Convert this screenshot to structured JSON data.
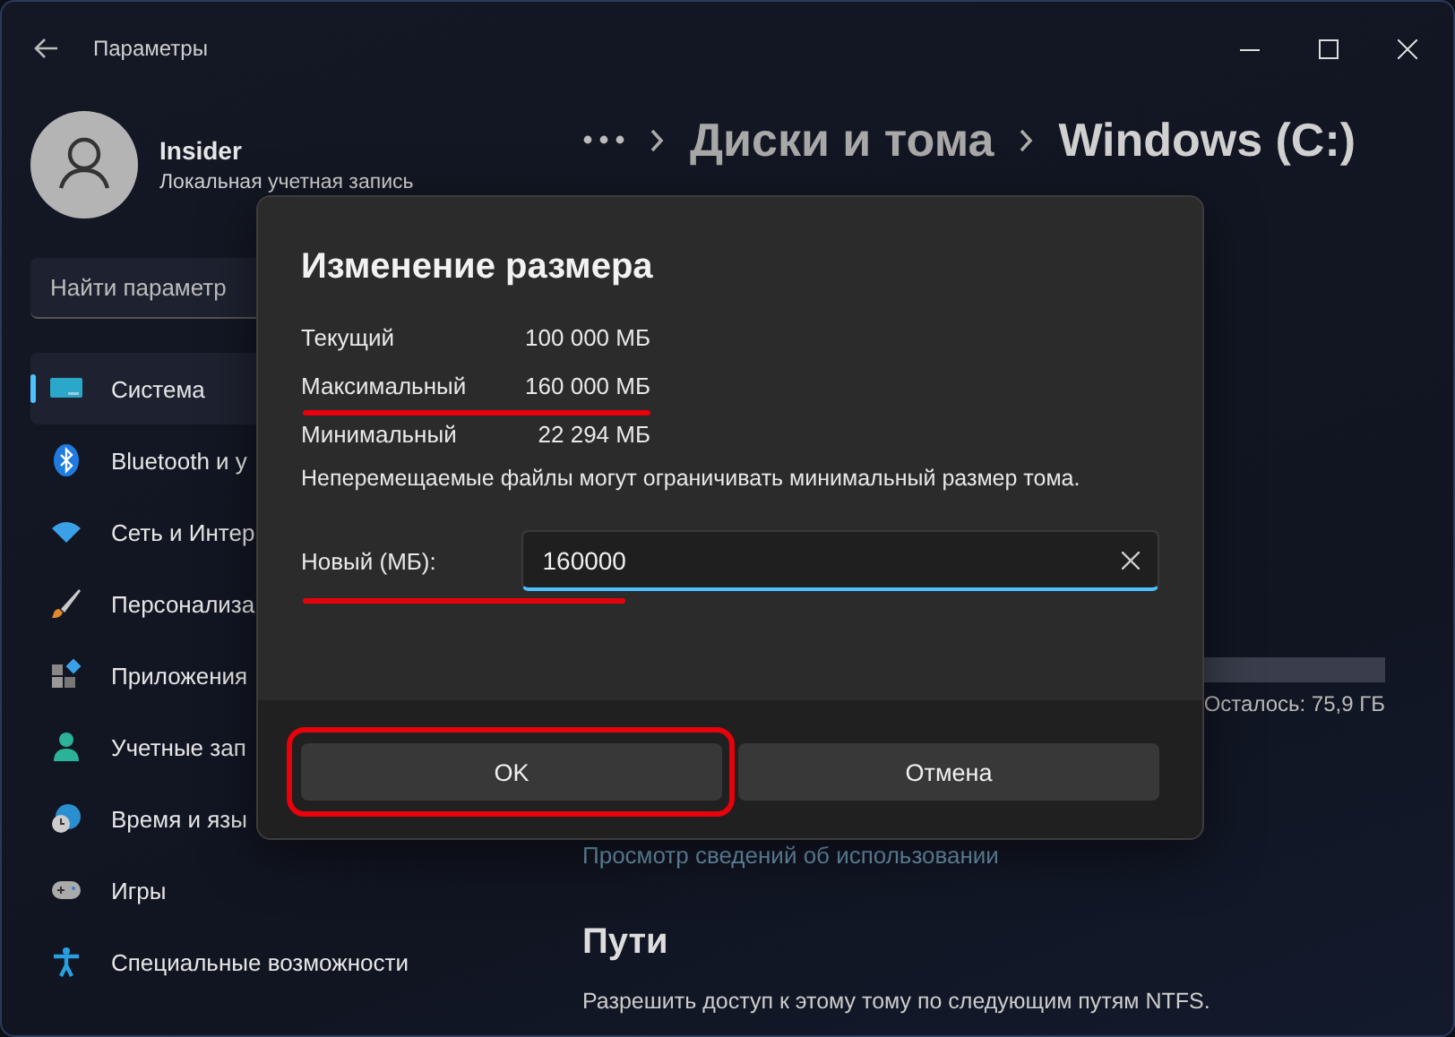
{
  "window": {
    "title": "Параметры"
  },
  "profile": {
    "name": "Insider",
    "account": "Локальная учетная запись"
  },
  "search": {
    "placeholder": "Найти параметр"
  },
  "sidebar": {
    "items": [
      {
        "label": "Система",
        "selected": true
      },
      {
        "label": "Bluetooth и у",
        "selected": false
      },
      {
        "label": "Сеть и Интер",
        "selected": false
      },
      {
        "label": "Персонализа",
        "selected": false
      },
      {
        "label": "Приложения",
        "selected": false
      },
      {
        "label": "Учетные зап",
        "selected": false
      },
      {
        "label": "Время и язы",
        "selected": false
      },
      {
        "label": "Игры",
        "selected": false
      },
      {
        "label": "Специальные возможности",
        "selected": false
      }
    ]
  },
  "breadcrumb": {
    "items": [
      {
        "label": "Диски и тома",
        "current": false
      },
      {
        "label": "Windows (C:)",
        "current": true
      }
    ]
  },
  "content": {
    "remaining": "Осталось: 75,9 ГБ",
    "usage_link": "Просмотр сведений об использовании",
    "paths_heading": "Пути",
    "paths_text": "Разрешить доступ к этому тому по следующим путям NTFS."
  },
  "dialog": {
    "title": "Изменение размера",
    "rows": [
      {
        "label": "Текущий",
        "value": "100 000 МБ",
        "underlined": false
      },
      {
        "label": "Максимальный",
        "value": "160 000 МБ",
        "underlined": true
      },
      {
        "label": "Минимальный",
        "value": "22 294 МБ",
        "underlined": false
      }
    ],
    "note": "Неперемещаемые файлы могут ограничивать минимальный размер тома.",
    "new_size": {
      "label": "Новый (МБ):",
      "value": "160000",
      "underlined": true
    },
    "buttons": [
      {
        "label": "OK",
        "framed": true
      },
      {
        "label": "Отмена",
        "framed": false
      }
    ]
  }
}
